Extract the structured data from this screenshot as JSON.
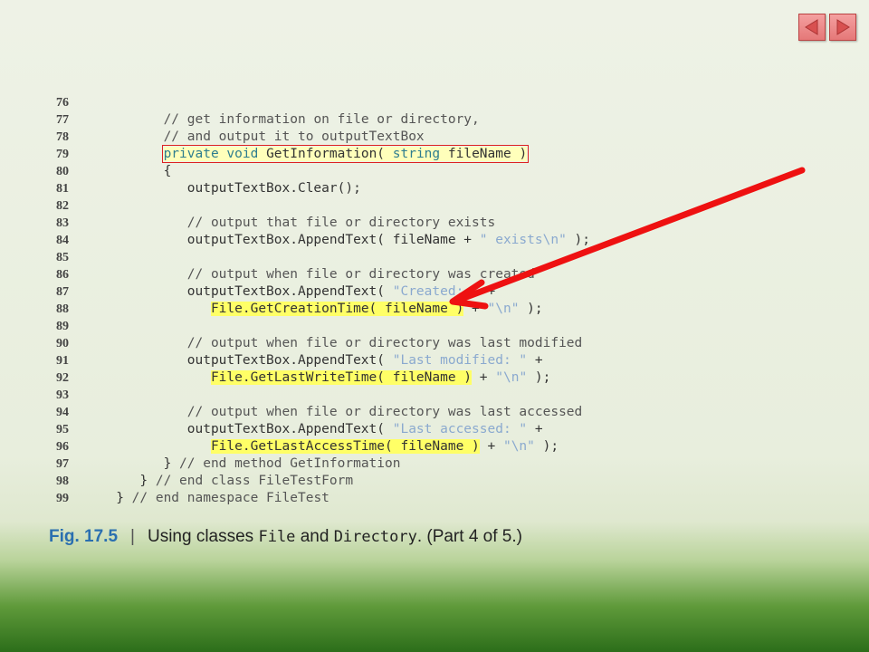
{
  "lines": [
    {
      "num": "76",
      "segs": []
    },
    {
      "num": "77",
      "segs": [
        {
          "t": "         "
        },
        {
          "t": "// get information on file or directory,",
          "c": "cm"
        }
      ]
    },
    {
      "num": "78",
      "segs": [
        {
          "t": "         "
        },
        {
          "t": "// and output it to outputTextBox",
          "c": "cm"
        }
      ]
    },
    {
      "num": "79",
      "segs": [
        {
          "t": "         "
        },
        {
          "t": "private void ",
          "c": "kw",
          "box": true
        },
        {
          "t": "GetInformation( ",
          "box": true
        },
        {
          "t": "string",
          "c": "kw",
          "box": true
        },
        {
          "t": " fileName )",
          "box": true
        }
      ]
    },
    {
      "num": "80",
      "segs": [
        {
          "t": "         {"
        }
      ]
    },
    {
      "num": "81",
      "segs": [
        {
          "t": "            outputTextBox.Clear();"
        }
      ]
    },
    {
      "num": "82",
      "segs": []
    },
    {
      "num": "83",
      "segs": [
        {
          "t": "            "
        },
        {
          "t": "// output that file or directory exists",
          "c": "cm"
        }
      ]
    },
    {
      "num": "84",
      "segs": [
        {
          "t": "            outputTextBox.AppendText( fileName + "
        },
        {
          "t": "\" exists\\n\"",
          "c": "st"
        },
        {
          "t": " );"
        }
      ]
    },
    {
      "num": "85",
      "segs": []
    },
    {
      "num": "86",
      "segs": [
        {
          "t": "            "
        },
        {
          "t": "// output when file or directory was created",
          "c": "cm"
        }
      ]
    },
    {
      "num": "87",
      "segs": [
        {
          "t": "            outputTextBox.AppendText( "
        },
        {
          "t": "\"Created: \"",
          "c": "st"
        },
        {
          "t": " +"
        }
      ]
    },
    {
      "num": "88",
      "segs": [
        {
          "t": "               "
        },
        {
          "t": "File.GetCreationTime( fileName )",
          "hl": true
        },
        {
          "t": " + "
        },
        {
          "t": "\"\\n\"",
          "c": "st"
        },
        {
          "t": " );"
        }
      ]
    },
    {
      "num": "89",
      "segs": []
    },
    {
      "num": "90",
      "segs": [
        {
          "t": "            "
        },
        {
          "t": "// output when file or directory was last modified",
          "c": "cm"
        }
      ]
    },
    {
      "num": "91",
      "segs": [
        {
          "t": "            outputTextBox.AppendText( "
        },
        {
          "t": "\"Last modified: \"",
          "c": "st"
        },
        {
          "t": " +"
        }
      ]
    },
    {
      "num": "92",
      "segs": [
        {
          "t": "               "
        },
        {
          "t": "File.GetLastWriteTime( fileName )",
          "hl": true
        },
        {
          "t": " + "
        },
        {
          "t": "\"\\n\"",
          "c": "st"
        },
        {
          "t": " );"
        }
      ]
    },
    {
      "num": "93",
      "segs": []
    },
    {
      "num": "94",
      "segs": [
        {
          "t": "            "
        },
        {
          "t": "// output when file or directory was last accessed",
          "c": "cm"
        }
      ]
    },
    {
      "num": "95",
      "segs": [
        {
          "t": "            outputTextBox.AppendText( "
        },
        {
          "t": "\"Last accessed: \"",
          "c": "st"
        },
        {
          "t": " +"
        }
      ]
    },
    {
      "num": "96",
      "segs": [
        {
          "t": "               "
        },
        {
          "t": "File.GetLastAccessTime( fileName )",
          "hl": true
        },
        {
          "t": " + "
        },
        {
          "t": "\"\\n\"",
          "c": "st"
        },
        {
          "t": " );"
        }
      ]
    },
    {
      "num": "97",
      "segs": [
        {
          "t": "         } "
        },
        {
          "t": "// end method GetInformation",
          "c": "cm"
        }
      ]
    },
    {
      "num": "98",
      "segs": [
        {
          "t": "      } "
        },
        {
          "t": "// end class FileTestForm",
          "c": "cm"
        }
      ]
    },
    {
      "num": "99",
      "segs": [
        {
          "t": "   } "
        },
        {
          "t": "// end namespace FileTest",
          "c": "cm"
        }
      ]
    }
  ],
  "caption": {
    "fig": "Fig. 17.5",
    "sep": "|",
    "pre": "Using classes ",
    "c1": "File",
    "mid": " and ",
    "c2": "Directory",
    "post": ". (Part 4 of 5.)"
  },
  "nav": {
    "prev_icon": "triangle-left-icon",
    "next_icon": "triangle-right-icon"
  },
  "colors": {
    "arrow": "#ee1111",
    "highlight": "#ffff66",
    "box": "#dd2222"
  }
}
